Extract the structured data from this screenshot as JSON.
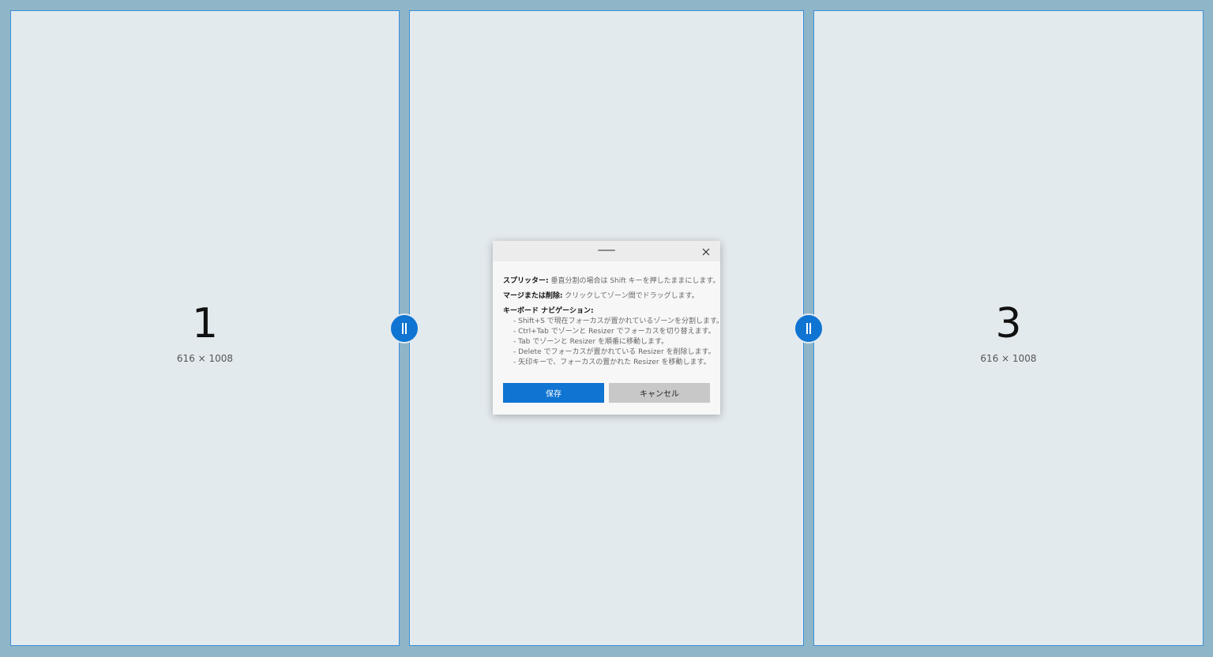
{
  "zones": [
    {
      "number": "1",
      "size": "616 × 1008"
    },
    {
      "number": "",
      "size": ""
    },
    {
      "number": "3",
      "size": "616 × 1008"
    }
  ],
  "resizers": [
    {
      "icon": "grip-vertical-icon"
    },
    {
      "icon": "grip-vertical-icon"
    }
  ],
  "dialog": {
    "close_icon": "close-icon",
    "splitter": {
      "label": "スプリッター:",
      "text": " 垂直分割の場合は Shift キーを押したままにします。"
    },
    "merge": {
      "label": "マージまたは削除:",
      "text": " クリックしてゾーン間でドラッグします。"
    },
    "keyboard": {
      "label": "キーボード ナビゲーション:",
      "items": [
        "- Shift+S で現在フォーカスが置かれているゾーンを分割します。",
        "- Ctrl+Tab でゾーンと Resizer でフォーカスを切り替えます。",
        "- Tab でゾーンと Resizer を順番に移動します。",
        "- Delete でフォーカスが置かれている Resizer を削除します。",
        "- 矢印キーで、フォーカスの置かれた Resizer を移動します。"
      ]
    },
    "save_label": "保存",
    "cancel_label": "キャンセル"
  }
}
